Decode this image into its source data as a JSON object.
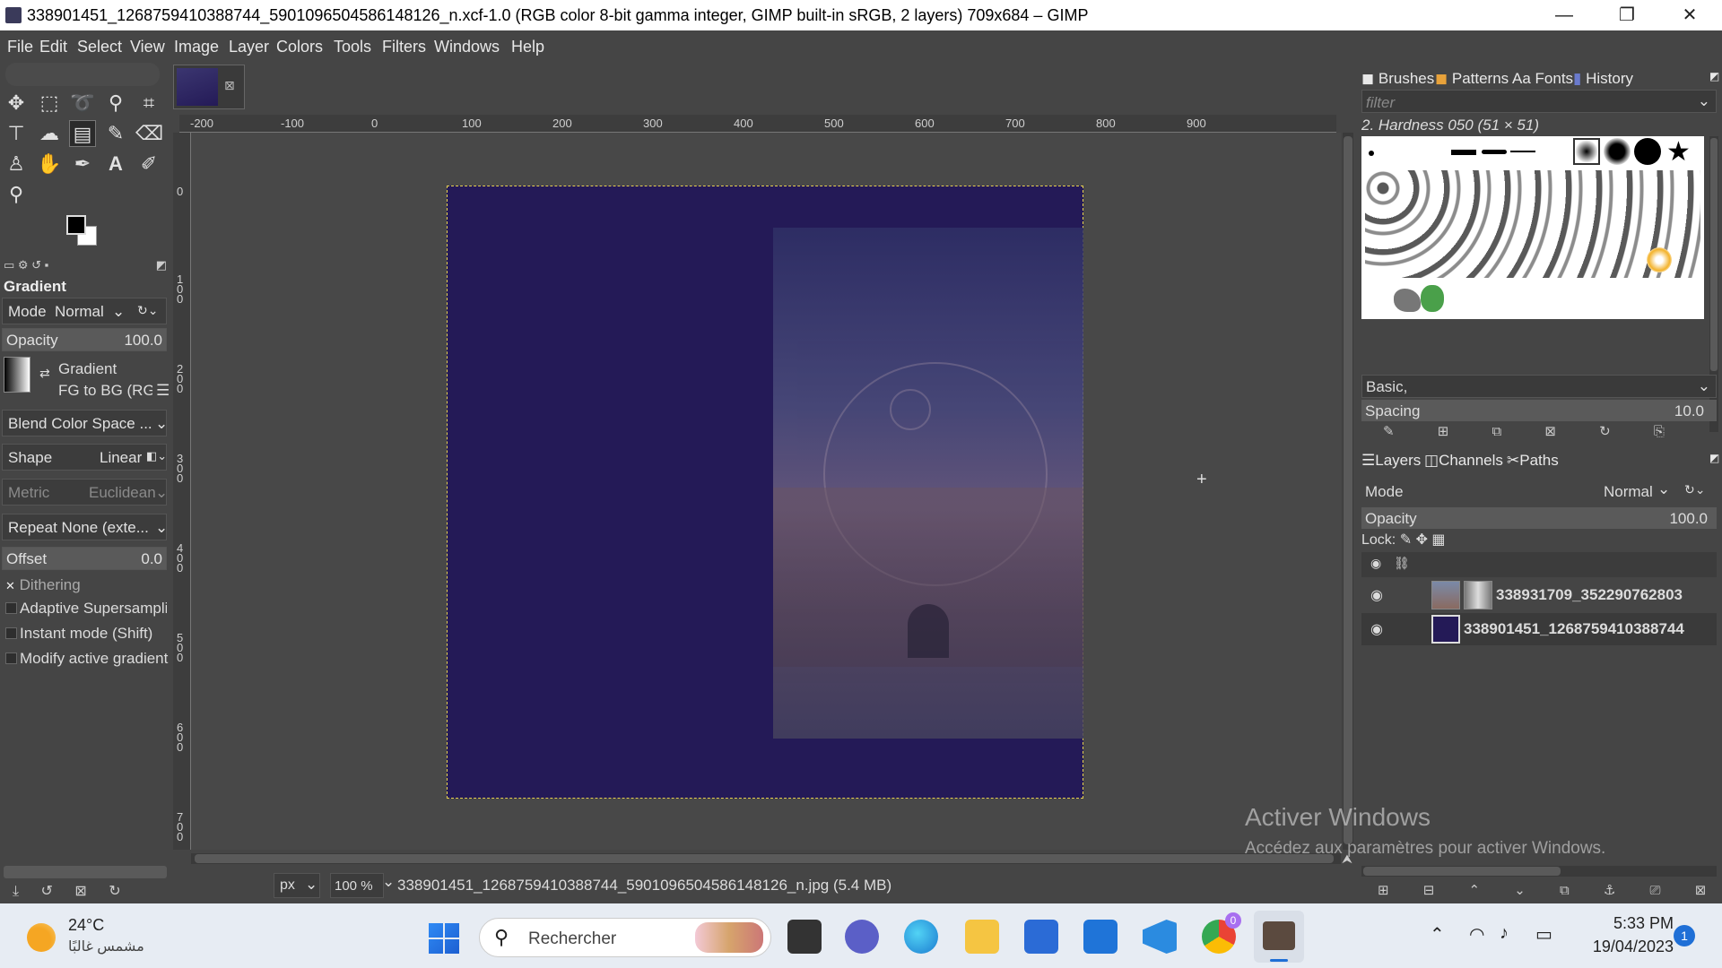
{
  "window": {
    "title": "338901451_1268759410388744_5901096504586148126_n.xcf-1.0 (RGB color 8-bit gamma integer, GIMP built-in sRGB, 2 layers) 709x684 – GIMP",
    "minimize": "—",
    "maximize": "❐",
    "close": "✕"
  },
  "menubar": [
    "File",
    "Edit",
    "Select",
    "View",
    "Image",
    "Layer",
    "Colors",
    "Tools",
    "Filters",
    "Windows",
    "Help"
  ],
  "tool_options": {
    "title": "Gradient",
    "mode_label": "Mode",
    "mode_value": "Normal",
    "opacity_label": "Opacity",
    "opacity_value": "100.0",
    "gradient_label": "Gradient",
    "gradient_value": "FG to BG (RG",
    "blend_color_space": "Blend Color Space ...",
    "shape_label": "Shape",
    "shape_value": "Linear",
    "metric_label": "Metric",
    "metric_value": "Euclidean",
    "repeat": "Repeat None (exte...",
    "offset_label": "Offset",
    "offset_value": "0.0",
    "dithering": "Dithering",
    "adaptive": "Adaptive Supersamplir",
    "instant": "Instant mode  (Shift)",
    "modify": "Modify active gradient"
  },
  "ruler": {
    "h": [
      "-200",
      "-100",
      "0",
      "100",
      "200",
      "300",
      "400",
      "500",
      "600",
      "700",
      "800",
      "900"
    ],
    "v": [
      "0",
      "1\n0\n0",
      "2\n0\n0",
      "3\n0\n0",
      "4\n0\n0",
      "5\n0\n0",
      "6\n0\n0",
      "7\n0\n0"
    ]
  },
  "status": {
    "unit": "px",
    "zoom": "100 %",
    "file": "338901451_1268759410388744_5901096504586148126_n.jpg (5.4 MB)"
  },
  "brushes_dock": {
    "tabs": [
      "Brushes",
      "Patterns",
      "Fonts",
      "History"
    ],
    "filter_placeholder": "filter",
    "brush_name": "2. Hardness 050 (51 × 51)",
    "preset": "Basic,",
    "spacing_label": "Spacing",
    "spacing_value": "10.0"
  },
  "layers_dock": {
    "tabs": [
      "Layers",
      "Channels",
      "Paths"
    ],
    "mode_label": "Mode",
    "mode_value": "Normal",
    "opacity_label": "Opacity",
    "opacity_value": "100.0",
    "lock_label": "Lock:",
    "layers": [
      {
        "name": "338931709_352290762803"
      },
      {
        "name": "338901451_1268759410388744"
      }
    ]
  },
  "watermark": {
    "title": "Activer Windows",
    "subtitle": "Accédez aux paramètres pour activer Windows."
  },
  "taskbar": {
    "weather_temp": "24°C",
    "weather_desc": "مشمس غالبًا",
    "search": "Rechercher",
    "time": "5:33 PM",
    "date": "19/04/2023",
    "notif_count": "1",
    "chrome_badge": "0"
  }
}
